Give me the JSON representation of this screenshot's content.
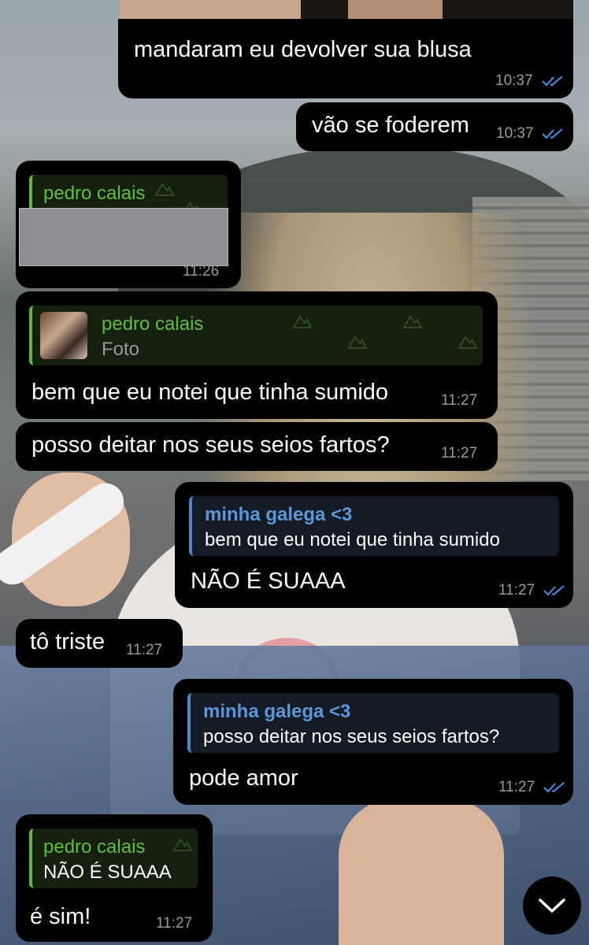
{
  "messages": {
    "m1": {
      "text": "mandaram eu devolver sua blusa",
      "time": "10:37",
      "read": true
    },
    "m2": {
      "text": "vão se foderem",
      "time": "10:37",
      "read": true
    },
    "m3": {
      "quote_author": "pedro calais",
      "time": "11:26",
      "hidden_text": "redacted"
    },
    "m4": {
      "quote_author": "pedro calais",
      "quote_text": "Foto",
      "text": "bem que eu notei que tinha sumido",
      "time": "11:27"
    },
    "m5": {
      "text": "posso deitar nos seus seios fartos?",
      "time": "11:27"
    },
    "m6": {
      "quote_author": "minha galega <3",
      "quote_text": "bem que eu notei que tinha sumido",
      "text": "NÃO É SUAAA",
      "time": "11:27",
      "read": true
    },
    "m7": {
      "text": "tô triste",
      "time": "11:27"
    },
    "m8": {
      "quote_author": "minha galega <3",
      "quote_text": "posso deitar nos seus seios fartos?",
      "text": "pode amor",
      "time": "11:27",
      "read": true
    },
    "m9": {
      "quote_author": "pedro calais",
      "quote_text": "NÃO É SUAAA",
      "text": "é sim!",
      "time": "11:27"
    }
  },
  "icons": {
    "read_receipt": "double-check-icon",
    "scroll_down": "chevron-down-icon",
    "quote_pattern": "mountain-pattern-icon",
    "photo_thumb": "photo-thumbnail"
  },
  "colors": {
    "bubble_bg": "#000000",
    "incoming_accent": "#62be40",
    "outgoing_accent": "#5b97d8",
    "timestamp": "#9a9a9a",
    "read_check": "#4a90e2"
  }
}
